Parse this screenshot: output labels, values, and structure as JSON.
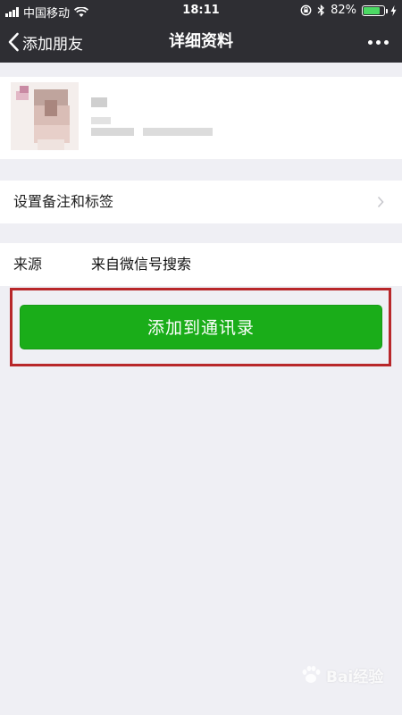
{
  "status_bar": {
    "carrier": "中国移动",
    "time": "18:11",
    "battery_percent": "82%",
    "battery_level": 0.82,
    "icons": [
      "signal-icon",
      "wifi-icon",
      "rotation-lock-icon",
      "bluetooth-icon",
      "battery-icon",
      "charging-icon"
    ]
  },
  "nav": {
    "back_label": "添加朋友",
    "title": "详细资料"
  },
  "cells": {
    "tag_label": "设置备注和标签",
    "source_label": "来源",
    "source_value": "来自微信号搜索"
  },
  "add_button": {
    "label": "添加到通讯录"
  },
  "watermark": {
    "text": "Bai经验"
  },
  "colors": {
    "nav_bg": "#2e2e33",
    "page_bg": "#efeff4",
    "button_green": "#1aad19",
    "highlight_red": "#b8272a"
  }
}
